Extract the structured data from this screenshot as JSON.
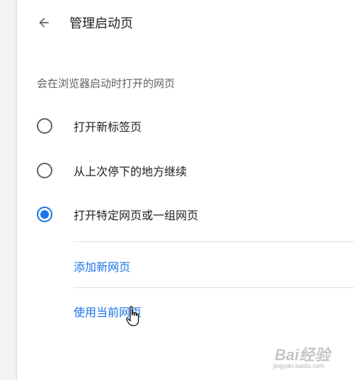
{
  "header": {
    "title": "管理启动页"
  },
  "description": "会在浏览器启动时打开的网页",
  "options": [
    {
      "label": "打开新标签页",
      "checked": false
    },
    {
      "label": "从上次停下的地方继续",
      "checked": false
    },
    {
      "label": "打开特定网页或一组网页",
      "checked": true
    }
  ],
  "links": {
    "add_page": "添加新网页",
    "use_current": "使用当前网页"
  },
  "watermark": {
    "text": "Bai经验",
    "url": "jingyan.baidu.com"
  },
  "colors": {
    "accent": "#1a73e8",
    "text": "#202124",
    "secondary": "#5f6368"
  }
}
